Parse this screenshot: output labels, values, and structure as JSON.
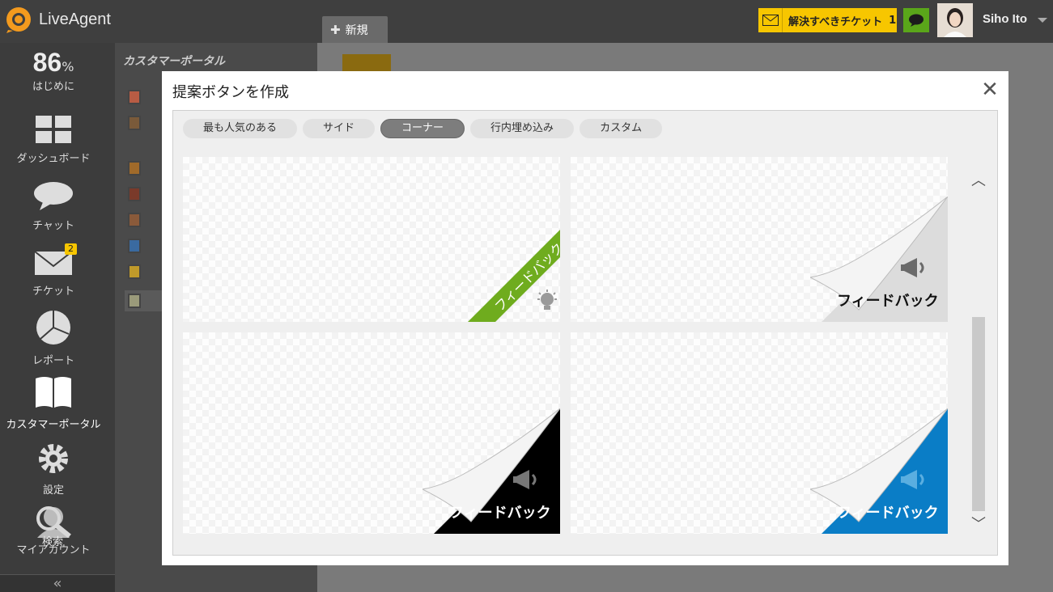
{
  "app": {
    "name": "LiveAgent"
  },
  "topbar": {
    "new_tab_label": "新規",
    "tickets_label": "解決すべきチケット",
    "tickets_count": "1",
    "user_name": "Siho Ito"
  },
  "leftnav": {
    "stat_value": "86",
    "stat_unit": "%",
    "stat_label": "はじめに",
    "items": [
      {
        "label": "ダッシュボード",
        "icon": "dashboard-icon"
      },
      {
        "label": "チャット",
        "icon": "chat-icon"
      },
      {
        "label": "チケット",
        "icon": "ticket-icon",
        "badge": "2"
      },
      {
        "label": "レポート",
        "icon": "report-icon"
      },
      {
        "label": "カスタマーポータル",
        "icon": "portal-icon"
      },
      {
        "label": "設定",
        "icon": "settings-icon"
      },
      {
        "label": "マイアカウント",
        "icon": "account-icon",
        "overlay": "検索"
      }
    ],
    "collapse_label": "«"
  },
  "panel2": {
    "title": "カスタマーポータル"
  },
  "modal": {
    "title": "提案ボタンを作成",
    "close_label": "✕",
    "tabs": [
      {
        "label": "最も人気のある",
        "active": false
      },
      {
        "label": "サイド",
        "active": false
      },
      {
        "label": "コーナー",
        "active": true
      },
      {
        "label": "行内埋め込み",
        "active": false
      },
      {
        "label": "カスタム",
        "active": false
      }
    ],
    "tiles": [
      {
        "label": "フィードバック",
        "style": "green-ribbon",
        "color": "#6fac1e"
      },
      {
        "label": "フィードバック",
        "style": "gray-peel",
        "color": "#d8d8d8"
      },
      {
        "label": "フィードバック",
        "style": "black-peel",
        "color": "#000000"
      },
      {
        "label": "フィードバック",
        "style": "blue-peel",
        "color": "#0a7dc6"
      }
    ]
  }
}
